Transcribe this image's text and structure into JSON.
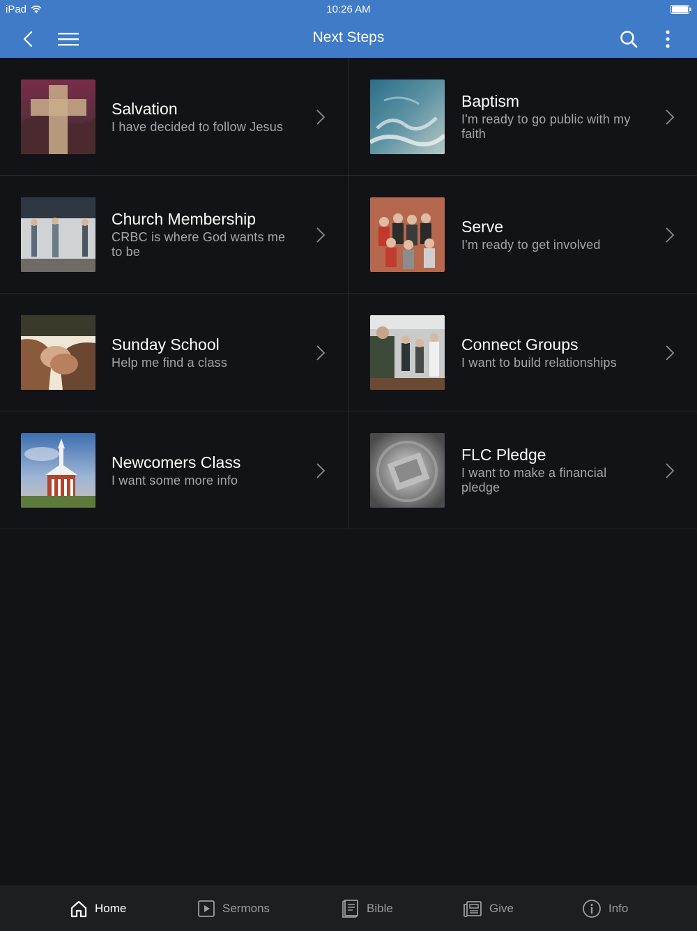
{
  "status_bar": {
    "device": "iPad",
    "time": "10:26 AM"
  },
  "header": {
    "title": "Next Steps"
  },
  "items": [
    {
      "title": "Salvation",
      "subtitle": "I have decided to follow Jesus",
      "image": "cross-over-hills"
    },
    {
      "title": "Baptism",
      "subtitle": "I'm ready to go public with my faith",
      "image": "water-waves"
    },
    {
      "title": "Church Membership",
      "subtitle": "CRBC is where God wants me to be",
      "image": "worship-band"
    },
    {
      "title": "Serve",
      "subtitle": "I'm ready to get involved",
      "image": "group-photo"
    },
    {
      "title": "Sunday School",
      "subtitle": "Help me find a class",
      "image": "praying-hands"
    },
    {
      "title": "Connect Groups",
      "subtitle": "I want to build relationships",
      "image": "people-talking"
    },
    {
      "title": "Newcomers Class",
      "subtitle": "I want some more info",
      "image": "church-building"
    },
    {
      "title": "FLC Pledge",
      "subtitle": "I want to make a financial pledge",
      "image": "money-jar"
    }
  ],
  "tabs": [
    {
      "label": "Home",
      "icon": "home-icon",
      "active": true
    },
    {
      "label": "Sermons",
      "icon": "play-icon",
      "active": false
    },
    {
      "label": "Bible",
      "icon": "book-icon",
      "active": false
    },
    {
      "label": "Give",
      "icon": "newspaper-icon",
      "active": false
    },
    {
      "label": "Info",
      "icon": "info-icon",
      "active": false
    }
  ],
  "colors": {
    "accent": "#3f7bc7",
    "background": "#121316",
    "tab_bar": "#1c1e21"
  }
}
